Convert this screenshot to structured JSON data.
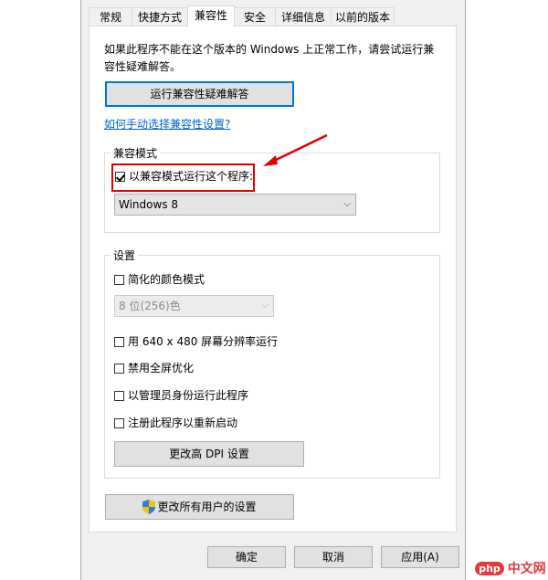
{
  "tabs": [
    {
      "label": "常规",
      "active": false
    },
    {
      "label": "快捷方式",
      "active": false
    },
    {
      "label": "兼容性",
      "active": true
    },
    {
      "label": "安全",
      "active": false
    },
    {
      "label": "详细信息",
      "active": false
    },
    {
      "label": "以前的版本",
      "active": false
    }
  ],
  "description": "如果此程序不能在这个版本的 Windows 上正常工作，请尝试运行兼容性疑难解答。",
  "troubleshooter_button": "运行兼容性疑难解答",
  "manual_link": "如何手动选择兼容性设置?",
  "compat_mode": {
    "title": "兼容模式",
    "checkbox_label": "以兼容模式运行这个程序:",
    "checked": true,
    "selected_os": "Windows 8"
  },
  "settings": {
    "title": "设置",
    "reduced_color": {
      "label": "简化的颜色模式",
      "checked": false
    },
    "color_select": "8 位(256)色",
    "res_640": {
      "label": "用 640 x 480 屏幕分辨率运行",
      "checked": false
    },
    "disable_fullscreen": {
      "label": "禁用全屏优化",
      "checked": false
    },
    "run_as_admin": {
      "label": "以管理员身份运行此程序",
      "checked": false
    },
    "register_restart": {
      "label": "注册此程序以重新启动",
      "checked": false
    },
    "dpi_button": "更改高 DPI 设置"
  },
  "all_users_button": "更改所有用户的设置",
  "footer": {
    "ok": "确定",
    "cancel": "取消",
    "apply": "应用(A)"
  },
  "watermark": {
    "badge": "php",
    "text": "中文网"
  },
  "colors": {
    "highlight": "#e10000",
    "link": "#0066cc",
    "accent": "#0078d7"
  }
}
